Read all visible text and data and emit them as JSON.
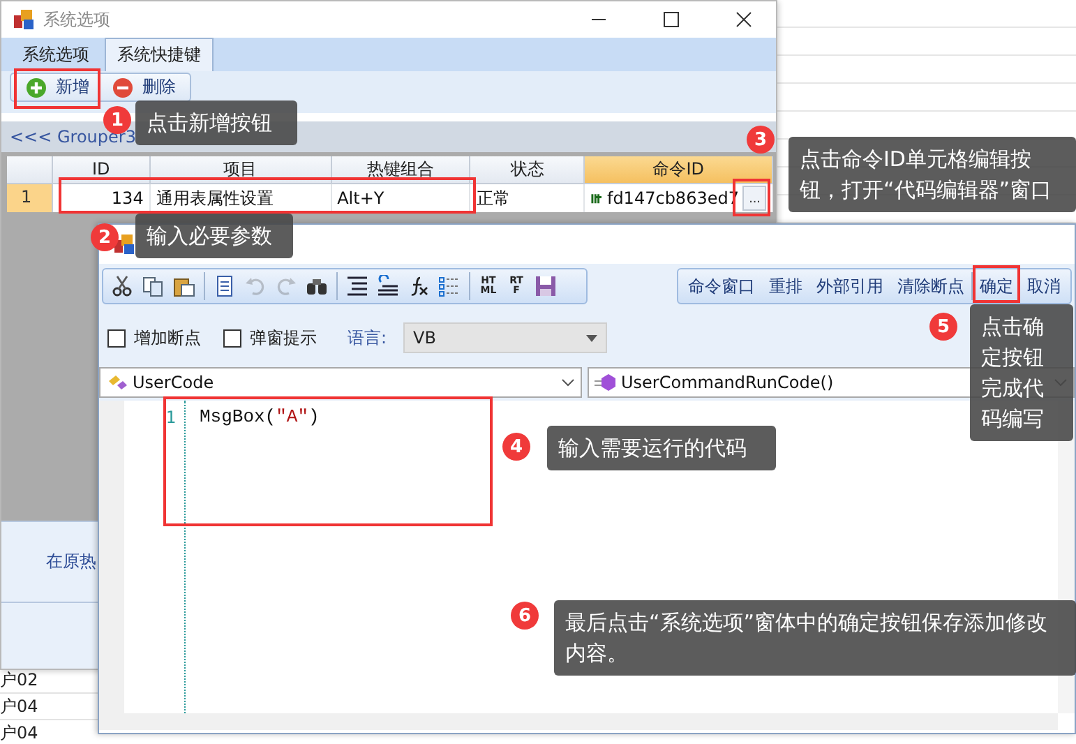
{
  "system_window": {
    "title": "系统选项",
    "tabs": [
      {
        "label": "系统选项",
        "selected": false
      },
      {
        "label": "系统快捷键",
        "selected": true
      }
    ],
    "toolbar": [
      {
        "label": "新增",
        "kind": "add"
      },
      {
        "label": "删除",
        "kind": "delete"
      }
    ],
    "group_link": "<<< Grouper3",
    "table": {
      "columns": [
        {
          "label": "ID",
          "selected": false
        },
        {
          "label": "项目",
          "selected": false
        },
        {
          "label": "热键组合",
          "selected": false
        },
        {
          "label": "状态",
          "selected": false
        },
        {
          "label": "命令ID",
          "selected": true
        }
      ],
      "rows": [
        {
          "number": "1",
          "selected": true,
          "cells": [
            "134",
            "通用表属性设置",
            "Alt+Y",
            "正常",
            "fd147cb863ed7"
          ],
          "edit_button": "..."
        }
      ]
    },
    "hint": "在原热"
  },
  "background_rows": [
    "户02",
    "户04",
    "户04"
  ],
  "editor": {
    "tools": [
      {
        "kind": "cut",
        "disabled": false
      },
      {
        "kind": "copy",
        "disabled": false
      },
      {
        "kind": "paste",
        "disabled": false
      },
      {
        "kind": "sep"
      },
      {
        "kind": "document",
        "disabled": false
      },
      {
        "kind": "undo",
        "disabled": true
      },
      {
        "kind": "redo",
        "disabled": true
      },
      {
        "kind": "find",
        "disabled": false
      },
      {
        "kind": "sep"
      },
      {
        "kind": "indent",
        "disabled": false
      },
      {
        "kind": "outdent",
        "disabled": false
      },
      {
        "kind": "function",
        "disabled": false
      },
      {
        "kind": "list",
        "disabled": false
      },
      {
        "kind": "sep"
      },
      {
        "kind": "html",
        "label": "HTML",
        "disabled": false
      },
      {
        "kind": "rtf",
        "label": "RTF",
        "disabled": false
      },
      {
        "kind": "save",
        "disabled": false
      }
    ],
    "actions": [
      "命令窗口",
      "重排",
      "外部引用",
      "清除断点",
      "确定",
      "取消"
    ],
    "options": [
      {
        "label": "增加断点",
        "checked": false
      },
      {
        "label": "弹窗提示",
        "checked": false
      }
    ],
    "language": {
      "label": "语言:",
      "value": "VB"
    },
    "object_select": "UserCode",
    "method_select": "UserCommandRunCode()",
    "code_lines": [
      {
        "number": "1",
        "tokens": [
          {
            "kind": "plain",
            "text": "MsgBox("
          },
          {
            "kind": "string",
            "text": "\"A\""
          },
          {
            "kind": "plain",
            "text": ")"
          }
        ]
      }
    ]
  },
  "callouts": [
    {
      "number": "1",
      "text": "点击新增按钮"
    },
    {
      "number": "2",
      "text": "输入必要参数"
    },
    {
      "number": "3",
      "text": "点击命令ID单元格编辑按钮，打开“代码编辑器”窗口"
    },
    {
      "number": "4",
      "text": "输入需要运行的代码"
    },
    {
      "number": "5",
      "text": "点击确定按钮完成代码编写"
    },
    {
      "number": "6",
      "text": "最后点击“系统选项”窗体中的确定按钮保存添加修改内容。"
    }
  ]
}
